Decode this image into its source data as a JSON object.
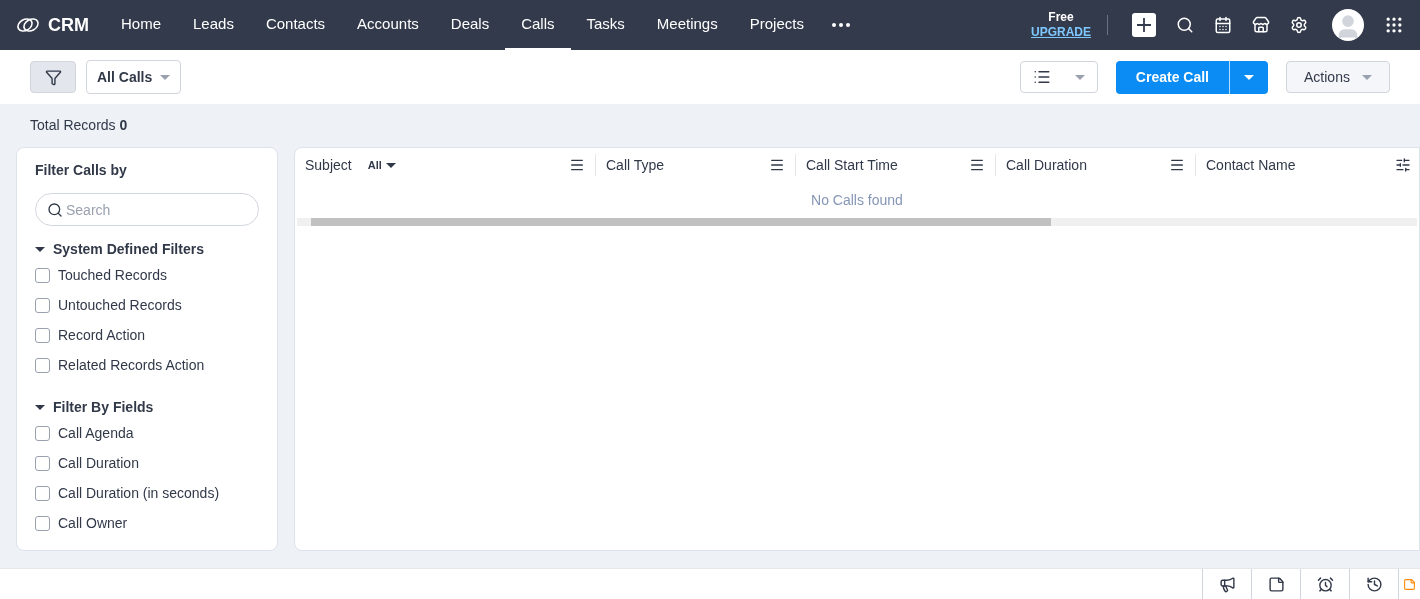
{
  "app": {
    "name": "CRM"
  },
  "nav": [
    {
      "label": "Home",
      "selected": false
    },
    {
      "label": "Leads",
      "selected": false
    },
    {
      "label": "Contacts",
      "selected": false
    },
    {
      "label": "Accounts",
      "selected": false
    },
    {
      "label": "Deals",
      "selected": false
    },
    {
      "label": "Calls",
      "selected": true
    },
    {
      "label": "Tasks",
      "selected": false
    },
    {
      "label": "Meetings",
      "selected": false
    },
    {
      "label": "Projects",
      "selected": false
    }
  ],
  "plan": {
    "name": "Free",
    "link": "UPGRADE"
  },
  "toolbar": {
    "view": "All Calls",
    "create": "Create Call",
    "actions": "Actions"
  },
  "total": {
    "label": "Total Records",
    "count": "0"
  },
  "filters": {
    "title": "Filter Calls by",
    "placeholder": "Search",
    "sections": [
      {
        "title": "System Defined Filters",
        "expanded": true,
        "items": [
          {
            "label": "Touched Records",
            "checked": false
          },
          {
            "label": "Untouched Records",
            "checked": false
          },
          {
            "label": "Record Action",
            "checked": false
          },
          {
            "label": "Related Records Action",
            "checked": false
          }
        ]
      },
      {
        "title": "Filter By Fields",
        "expanded": true,
        "items": [
          {
            "label": "Call Agenda",
            "checked": false
          },
          {
            "label": "Call Duration",
            "checked": false
          },
          {
            "label": "Call Duration (in seconds)",
            "checked": false
          },
          {
            "label": "Call Owner",
            "checked": false
          }
        ]
      }
    ]
  },
  "table": {
    "subject_filter": "All",
    "columns": [
      "Subject",
      "Call Type",
      "Call Start Time",
      "Call Duration",
      "Contact Name"
    ],
    "empty": "No Calls found"
  }
}
